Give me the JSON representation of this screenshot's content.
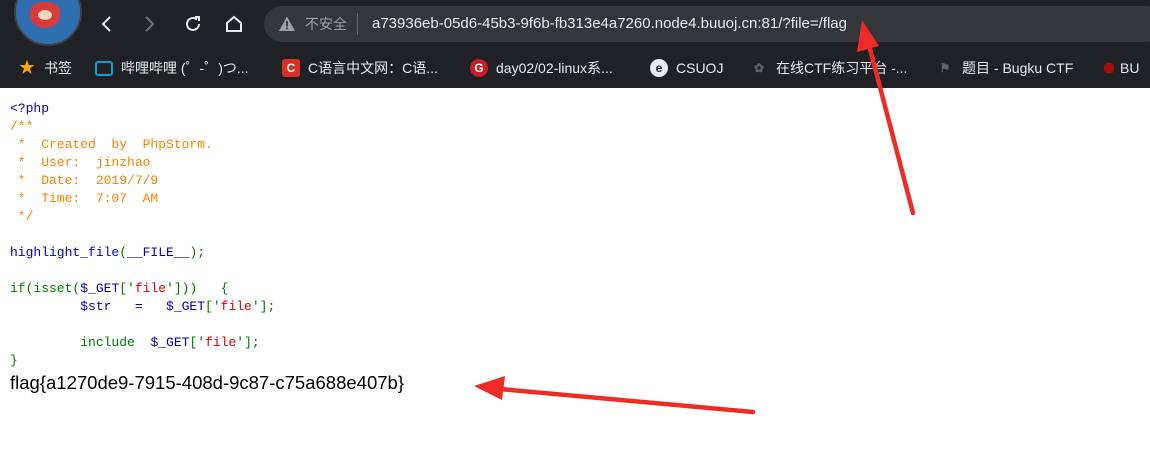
{
  "browser": {
    "security_label": "不安全",
    "url": "a73936eb-05d6-45b3-9f6b-fb313e4a7260.node4.buuoj.cn:81/?file=/flag",
    "bookmarks": [
      {
        "label": "书签",
        "icon": "star-icon",
        "color": "#f9ab00"
      },
      {
        "label": "哔哩哔哩 (゜-゜)つ...",
        "icon": "bilibili-icon",
        "color": "#00a1d6"
      },
      {
        "label": "C语言中文网：C语...",
        "icon": "c-icon",
        "color": "#d93025"
      },
      {
        "label": "day02/02-linux系...",
        "icon": "gitee-icon",
        "color": "#c71d23"
      },
      {
        "label": "CSUOJ",
        "icon": "csuoj-icon",
        "color": "#e8eaed"
      },
      {
        "label": "在线CTF练习平台 -...",
        "icon": "ctf-icon",
        "color": "#5f6368"
      },
      {
        "label": "题目 - Bugku CTF",
        "icon": "flag-icon",
        "color": "#5f6368"
      },
      {
        "label": "BU",
        "icon": "buu-icon",
        "color": "#a50e0e"
      }
    ]
  },
  "code": {
    "lines": [
      [
        {
          "t": "<?php",
          "c": "blue"
        }
      ],
      [
        {
          "t": "/**",
          "c": "orange"
        }
      ],
      [
        {
          "t": " *  Created  by  PhpStorm.",
          "c": "orange"
        }
      ],
      [
        {
          "t": " *  User:  jinzhao",
          "c": "orange"
        }
      ],
      [
        {
          "t": " *  Date:  2019/7/9",
          "c": "orange"
        }
      ],
      [
        {
          "t": " *  Time:  7:07  AM",
          "c": "orange"
        }
      ],
      [
        {
          "t": " */",
          "c": "orange"
        }
      ],
      [
        {
          "t": "",
          "c": "blue"
        }
      ],
      [
        {
          "t": "highlight_file",
          "c": "blue"
        },
        {
          "t": "(",
          "c": "green"
        },
        {
          "t": "__FILE__",
          "c": "blue"
        },
        {
          "t": ");",
          "c": "green"
        }
      ],
      [
        {
          "t": "",
          "c": "blue"
        }
      ],
      [
        {
          "t": "if(",
          "c": "green"
        },
        {
          "t": "isset",
          "c": "green"
        },
        {
          "t": "(",
          "c": "green"
        },
        {
          "t": "$_GET",
          "c": "blue"
        },
        {
          "t": "['",
          "c": "green"
        },
        {
          "t": "file",
          "c": "red"
        },
        {
          "t": "']))   {",
          "c": "green"
        }
      ],
      [
        {
          "t": "         $str   =   $_GET",
          "c": "blue"
        },
        {
          "t": "['",
          "c": "green"
        },
        {
          "t": "file",
          "c": "red"
        },
        {
          "t": "'];",
          "c": "green"
        }
      ],
      [
        {
          "t": "",
          "c": "blue"
        }
      ],
      [
        {
          "t": "         include  ",
          "c": "green"
        },
        {
          "t": "$_GET",
          "c": "blue"
        },
        {
          "t": "['",
          "c": "green"
        },
        {
          "t": "file",
          "c": "red"
        },
        {
          "t": "'];",
          "c": "green"
        }
      ],
      [
        {
          "t": "}",
          "c": "green"
        }
      ]
    ]
  },
  "output": {
    "flag": "flag{a1270de9-7915-408d-9c87-c75a688e407b}"
  },
  "colors": {
    "arrow": "#ee2b24"
  }
}
